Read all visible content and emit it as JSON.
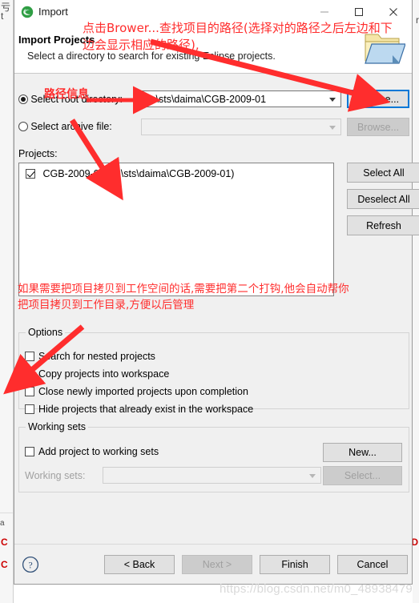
{
  "window": {
    "title": "Import",
    "icon": "eclipse-icon",
    "controls": {
      "minimize": "minimize-icon",
      "maximize": "maximize-icon",
      "close": "close-icon"
    }
  },
  "header": {
    "title": "Import Projects",
    "subtitle": "Select a directory to search for existing Eclipse projects.",
    "icon": "import-folder-icon"
  },
  "source": {
    "root_directory": {
      "label": "Select root directory:",
      "selected": true,
      "value": "D:\\sts\\daima\\CGB-2009-01",
      "browse_label": "Browse..."
    },
    "archive_file": {
      "label": "Select archive file:",
      "selected": false,
      "value": "",
      "browse_label": "Browse..."
    }
  },
  "projects": {
    "label": "Projects:",
    "items": [
      {
        "label": "CGB-2009-01 (D:\\sts\\daima\\CGB-2009-01)",
        "checked": true
      }
    ],
    "buttons": {
      "select_all": "Select All",
      "deselect_all": "Deselect All",
      "refresh": "Refresh"
    }
  },
  "options": {
    "title": "Options",
    "items": [
      {
        "label": "Search for nested projects",
        "checked": false
      },
      {
        "label": "Copy projects into workspace",
        "checked": false
      },
      {
        "label": "Close newly imported projects upon completion",
        "checked": false
      },
      {
        "label": "Hide projects that already exist in the workspace",
        "checked": false
      }
    ]
  },
  "working_sets": {
    "title": "Working sets",
    "add_checkbox": {
      "label": "Add project to working sets",
      "checked": false
    },
    "new_label": "New...",
    "field_label": "Working sets:",
    "field_value": "",
    "select_label": "Select..."
  },
  "footer": {
    "help_icon": "help-icon",
    "back_label": "< Back",
    "next_label": "Next >",
    "finish_label": "Finish",
    "cancel_label": "Cancel"
  },
  "annotations": {
    "top_line1": "点击Brower...查找项目的路径(选择对的路径之后左边和下",
    "top_line2": "边会显示相应的路径),",
    "path_info": "路径信息",
    "mid_line1": "如果需要把项目拷贝到工作空间的话,需要把第二个打钩,他会自动帮你",
    "mid_line2": "把项目拷贝到工作目录,方便以后管理",
    "arrow_color": "#ff2d2d"
  },
  "watermark": "https://blog.csdn.net/m0_48938479",
  "background": {
    "left_glyph_top": "亏",
    "left_glyph_top2": "t",
    "right_glyph": "r",
    "left_text_bottom": "a"
  },
  "colors": {
    "dialog_bg": "#f0f0f0",
    "accent_focus": "#0078d7",
    "annotation_red": "#ff2d2d",
    "watermark_gray": "#d9d9d9"
  }
}
